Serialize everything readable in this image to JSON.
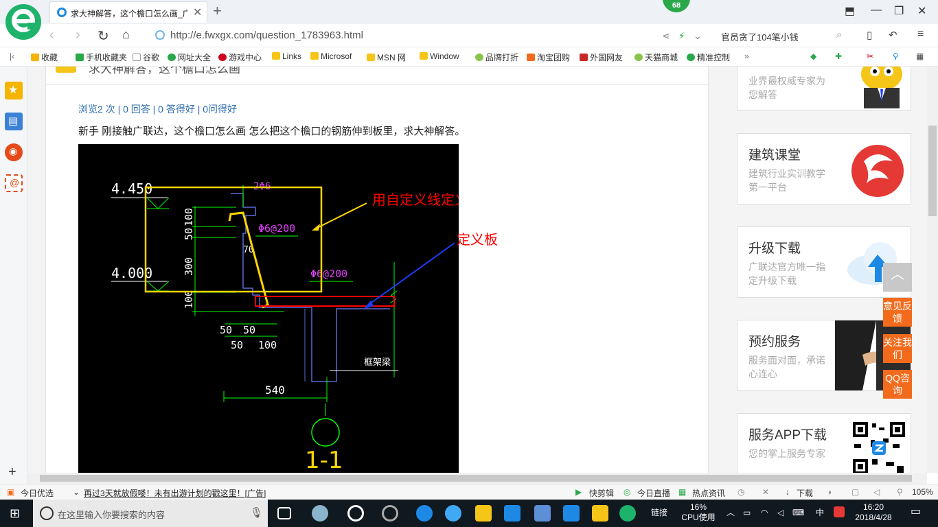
{
  "browser": {
    "tab_title": "求大神解答，这个檐口怎么画_广联",
    "badge": "68",
    "url": "http://e.fwxgx.com/question_1783963.html",
    "search_text": "官员贪了104笔小钱"
  },
  "bookmarks": [
    "收藏",
    "手机收藏夹",
    "谷歌",
    "网址大全",
    "游戏中心",
    "Links",
    "Microsof",
    "MSN 网",
    "Window",
    "品牌打折",
    "淘宝团购",
    "外国网友",
    "天猫商城",
    "精准控制"
  ],
  "page": {
    "header_title": "求大神解答，这个檐口怎么画",
    "stats": "浏览2 次 | 0 回答 | 0 答得好 | 0问得好",
    "question": "新手 刚接触广联达，这个檐口怎么画  怎么把这个檐口的钢筋伸到板里，求大神解答。"
  },
  "drawing": {
    "elev_top": "4.450",
    "elev_bottom": "4.000",
    "dim_100": "100",
    "dim_50": "50",
    "dim_300": "300",
    "dim_100_bottom": "100",
    "rebar_top": "2Φ6",
    "rebar_side": "Φ6@200",
    "rebar_slab": "Φ6@200",
    "dim_70": "70",
    "dims_row1": [
      "50",
      "50"
    ],
    "dims_row2": [
      "50",
      "100"
    ],
    "dim_540": "540",
    "beam_label": "框架梁",
    "section_label": "1-1",
    "note_custom_line": "用自定义线定义",
    "note_slab": "定义板"
  },
  "promos": [
    {
      "title": "",
      "sub": "业界最权威专家为您解答"
    },
    {
      "title": "建筑课堂",
      "sub": "建筑行业实训教学第一平台"
    },
    {
      "title": "升级下载",
      "sub": "广联达官方唯一指定升级下载"
    },
    {
      "title": "预约服务",
      "sub": "服务面对面，承诺心连心"
    },
    {
      "title": "服务APP下载",
      "sub": "您的掌上服务专家"
    }
  ],
  "float_buttons": [
    "意见反馈",
    "关注我们",
    "QQ咨询"
  ],
  "statusbar": {
    "left": "今日优选",
    "ad": "再过3天就放假喽！未有出游计划的戳这里！[广告]",
    "items": [
      "快剪辑",
      "今日直播",
      "热点资讯",
      "下载"
    ],
    "zoom": "105%"
  },
  "taskbar": {
    "search_placeholder": "在这里输入你要搜索的内容",
    "links": "链接",
    "cpu": "16%",
    "cpu_label": "CPU使用",
    "ime": "中",
    "time": "16:20",
    "date": "2018/4/28"
  },
  "colors": {
    "accent_green": "#1db36b",
    "orange": "#f26b1d",
    "link_blue": "#2b6cb0"
  }
}
